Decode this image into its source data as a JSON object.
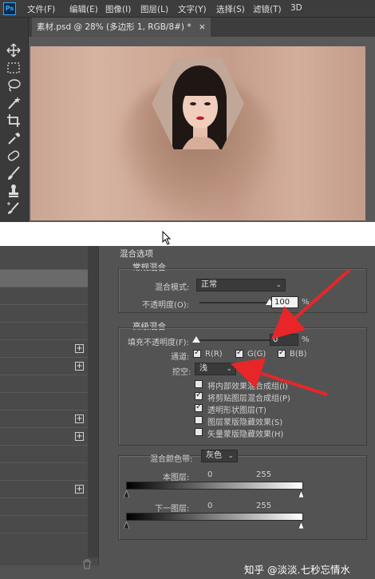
{
  "menubar": {
    "items": [
      "文件(F)",
      "编辑(E)",
      "图像(I)",
      "图层(L)",
      "文字(Y)",
      "选择(S)",
      "滤镜(T)",
      "3D"
    ]
  },
  "document": {
    "tab_label": "素材.psd @ 28% (多边形 1, RGB/8#) *",
    "close_glyph": "×"
  },
  "tools": [
    "move-tool-icon",
    "marquee-tool-icon",
    "lasso-tool-icon",
    "magic-wand-icon",
    "crop-tool-icon",
    "eyedropper-icon",
    "healing-brush-icon",
    "brush-tool-icon",
    "clone-stamp-icon",
    "history-brush-icon"
  ],
  "layer_style_list": {
    "plus_glyph": "+"
  },
  "blending_options": {
    "title": "混合选项",
    "general": {
      "title": "常规混合",
      "blend_mode_label": "混合模式:",
      "blend_mode_value": "正常",
      "opacity_label": "不透明度(O):",
      "opacity_value": "100",
      "opacity_unit": "%",
      "opacity_percent": 100
    },
    "advanced": {
      "title": "高级混合",
      "fill_opacity_label": "填充不透明度(F):",
      "fill_opacity_value": "0",
      "fill_opacity_unit": "%",
      "fill_opacity_percent": 0,
      "channels_label": "通道:",
      "channel_r": "R(R)",
      "channel_g": "G(G)",
      "channel_b": "B(B)",
      "knockout_label": "挖空:",
      "knockout_value": "浅",
      "options": [
        {
          "label": "将内部效果混合成组(I)",
          "checked": false
        },
        {
          "label": "将剪贴图层混合成组(P)",
          "checked": true
        },
        {
          "label": "透明形状图层(T)",
          "checked": true
        },
        {
          "label": "图层蒙版隐藏效果(S)",
          "checked": false
        },
        {
          "label": "矢量蒙版隐藏效果(H)",
          "checked": false
        }
      ]
    },
    "blend_if": {
      "label": "混合颜色带:",
      "value": "灰色",
      "this_layer_label": "本图层:",
      "this_layer_min": "0",
      "this_layer_max": "255",
      "underlying_label": "下一图层:",
      "underlying_min": "0",
      "underlying_max": "255"
    }
  },
  "watermark": "知乎 @淡淡.七秒忘情水",
  "colors": {
    "panel_bg": "#535353",
    "annotation_arrow": "#e8262a"
  }
}
